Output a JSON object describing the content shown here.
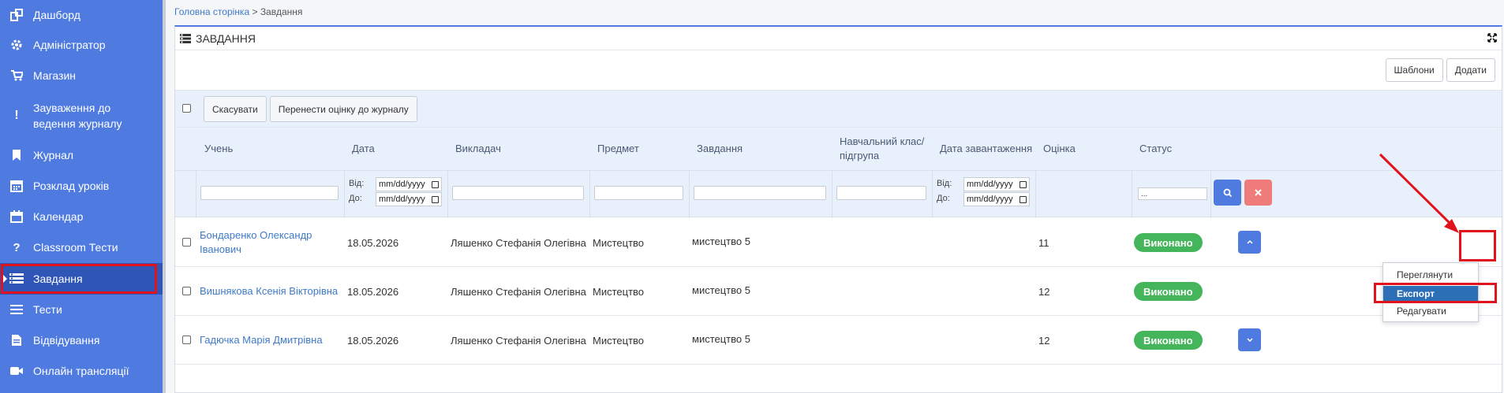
{
  "sidebar": {
    "items": [
      {
        "label": "Дашборд",
        "icon": "dashboard-icon"
      },
      {
        "label": "Адміністратор",
        "icon": "gear-icon"
      },
      {
        "label": "Магазин",
        "icon": "cart-icon"
      },
      {
        "label": "Зауваження до\nведення журналу",
        "icon": "exclamation-icon"
      },
      {
        "label": "Журнал",
        "icon": "bookmark-icon"
      },
      {
        "label": "Розклад уроків",
        "icon": "calendar-grid-icon"
      },
      {
        "label": "Календар",
        "icon": "calendar-icon"
      },
      {
        "label": "Classroom Тести",
        "icon": "question-icon"
      },
      {
        "label": "Завдання",
        "icon": "tasks-icon"
      },
      {
        "label": "Тести",
        "icon": "list-icon"
      },
      {
        "label": "Відвідування",
        "icon": "document-icon"
      },
      {
        "label": "Онлайн трансляції",
        "icon": "video-icon"
      }
    ],
    "active_index": 8
  },
  "breadcrumb": {
    "home": "Головна сторінка",
    "separator": " > ",
    "current": "Завдання"
  },
  "panel": {
    "title": "ЗАВДАННЯ",
    "templates_label": "Шаблони",
    "add_label": "Додати",
    "cancel_label": "Скасувати",
    "move_grade_label": "Перенести оцінку до журналу"
  },
  "table": {
    "columns": [
      "Учень",
      "Дата",
      "Викладач",
      "Предмет",
      "Завдання",
      "Навчальний клас/\nпідгрупа",
      "Дата завантаження",
      "Оцінка",
      "Статус"
    ],
    "filters": {
      "from_label": "Від:",
      "to_label": "До:",
      "date_placeholder": "mm/dd/yyyy",
      "status_select": "..."
    },
    "rows": [
      {
        "student": "Бондаренко Олександр\nІванович",
        "date": "18.05.2026",
        "teacher": "Ляшенко Стефанія Олегівна",
        "subject": "Мистецтво",
        "task": "мистецтво 5",
        "class": "",
        "upload_date": "",
        "grade": "11",
        "status": "Виконано"
      },
      {
        "student": "Вишнякова Ксенія Вікторівна",
        "date": "18.05.2026",
        "teacher": "Ляшенко Стефанія Олегівна",
        "subject": "Мистецтво",
        "task": "мистецтво 5",
        "class": "",
        "upload_date": "",
        "grade": "12",
        "status": "Виконано"
      },
      {
        "student": "Гадючка Марія Дмитрівна",
        "date": "18.05.2026",
        "teacher": "Ляшенко Стефанія Олегівна",
        "subject": "Мистецтво",
        "task": "мистецтво 5",
        "class": "",
        "upload_date": "",
        "grade": "12",
        "status": "Виконано"
      }
    ]
  },
  "dropdown": {
    "items": [
      "Переглянути",
      "Експорт",
      "Редагувати"
    ],
    "selected_index": 1
  },
  "colors": {
    "sidebar": "#4f7be0",
    "sidebar_active": "#2f55b7",
    "accent": "#4f7be0",
    "success": "#44b55b",
    "danger": "#ef7b7b",
    "highlight": "#e0121b",
    "link": "#3f7ac8"
  }
}
